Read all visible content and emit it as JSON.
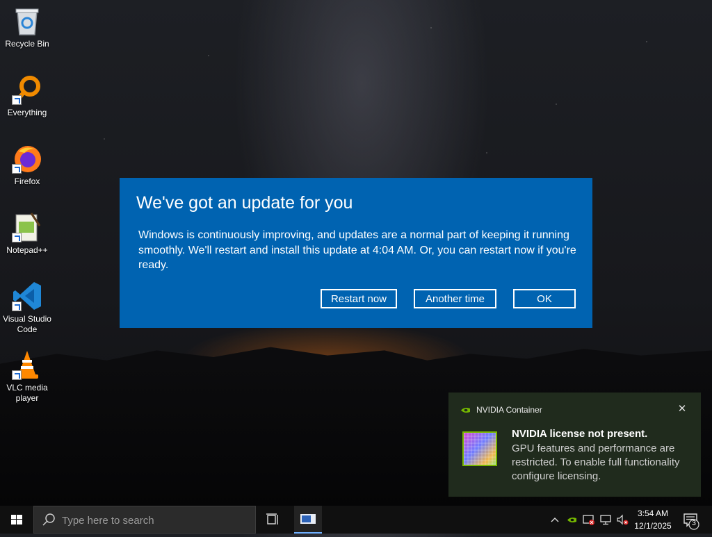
{
  "desktop": {
    "icons": [
      {
        "label": "Recycle Bin"
      },
      {
        "label": "Everything"
      },
      {
        "label": "Firefox"
      },
      {
        "label": "Notepad++"
      },
      {
        "label": "Visual Studio Code"
      },
      {
        "label": "VLC media player"
      }
    ]
  },
  "dialog": {
    "title": "We've got an update for you",
    "body": "Windows is continuously improving, and updates are a normal part of keeping it running smoothly. We'll restart and install this update at 4:04 AM. Or, you can restart now if you're ready.",
    "buttons": {
      "restart": "Restart now",
      "another": "Another time",
      "ok": "OK"
    },
    "background_color": "#0063b1"
  },
  "notification": {
    "app_name": "NVIDIA Container",
    "close_glyph": "✕",
    "heading": "NVIDIA license not present.",
    "text": "GPU features and performance are restricted. To enable full functionality configure licensing."
  },
  "taskbar": {
    "search_placeholder": "Type here to search",
    "clock": {
      "time": "3:54 AM",
      "date": "12/1/2025"
    },
    "notification_count": "3"
  }
}
